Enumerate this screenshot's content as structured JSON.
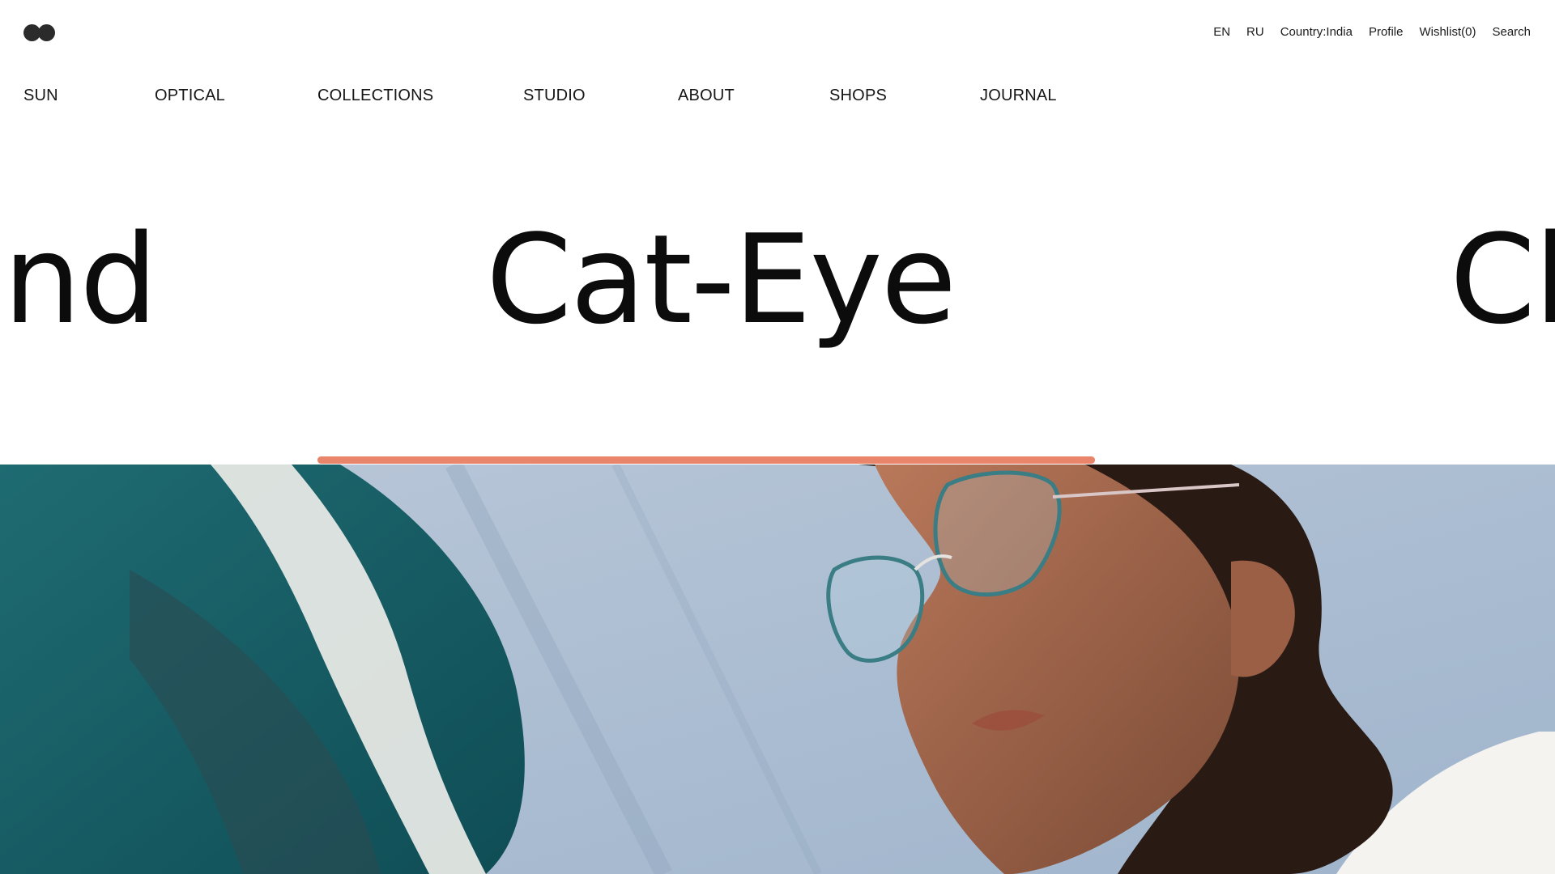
{
  "brand": {
    "logo_icon": "two-dot-logo-icon"
  },
  "utility_nav": {
    "items": [
      "EN",
      "RU",
      "Country:India",
      "Profile",
      "Wishlist(0)",
      "Search"
    ]
  },
  "main_nav": {
    "items": [
      "SUN",
      "OPTICAL",
      "COLLECTIONS",
      "STUDIO",
      "ABOUT",
      "SHOPS",
      "JOURNAL"
    ]
  },
  "hero": {
    "carousel_words": [
      "nd",
      "Cat-Eye",
      "Cl"
    ],
    "progress_fraction": 1.0,
    "accent_color": "#E8856B",
    "image_description_icon": "portrait-photo-icon"
  }
}
